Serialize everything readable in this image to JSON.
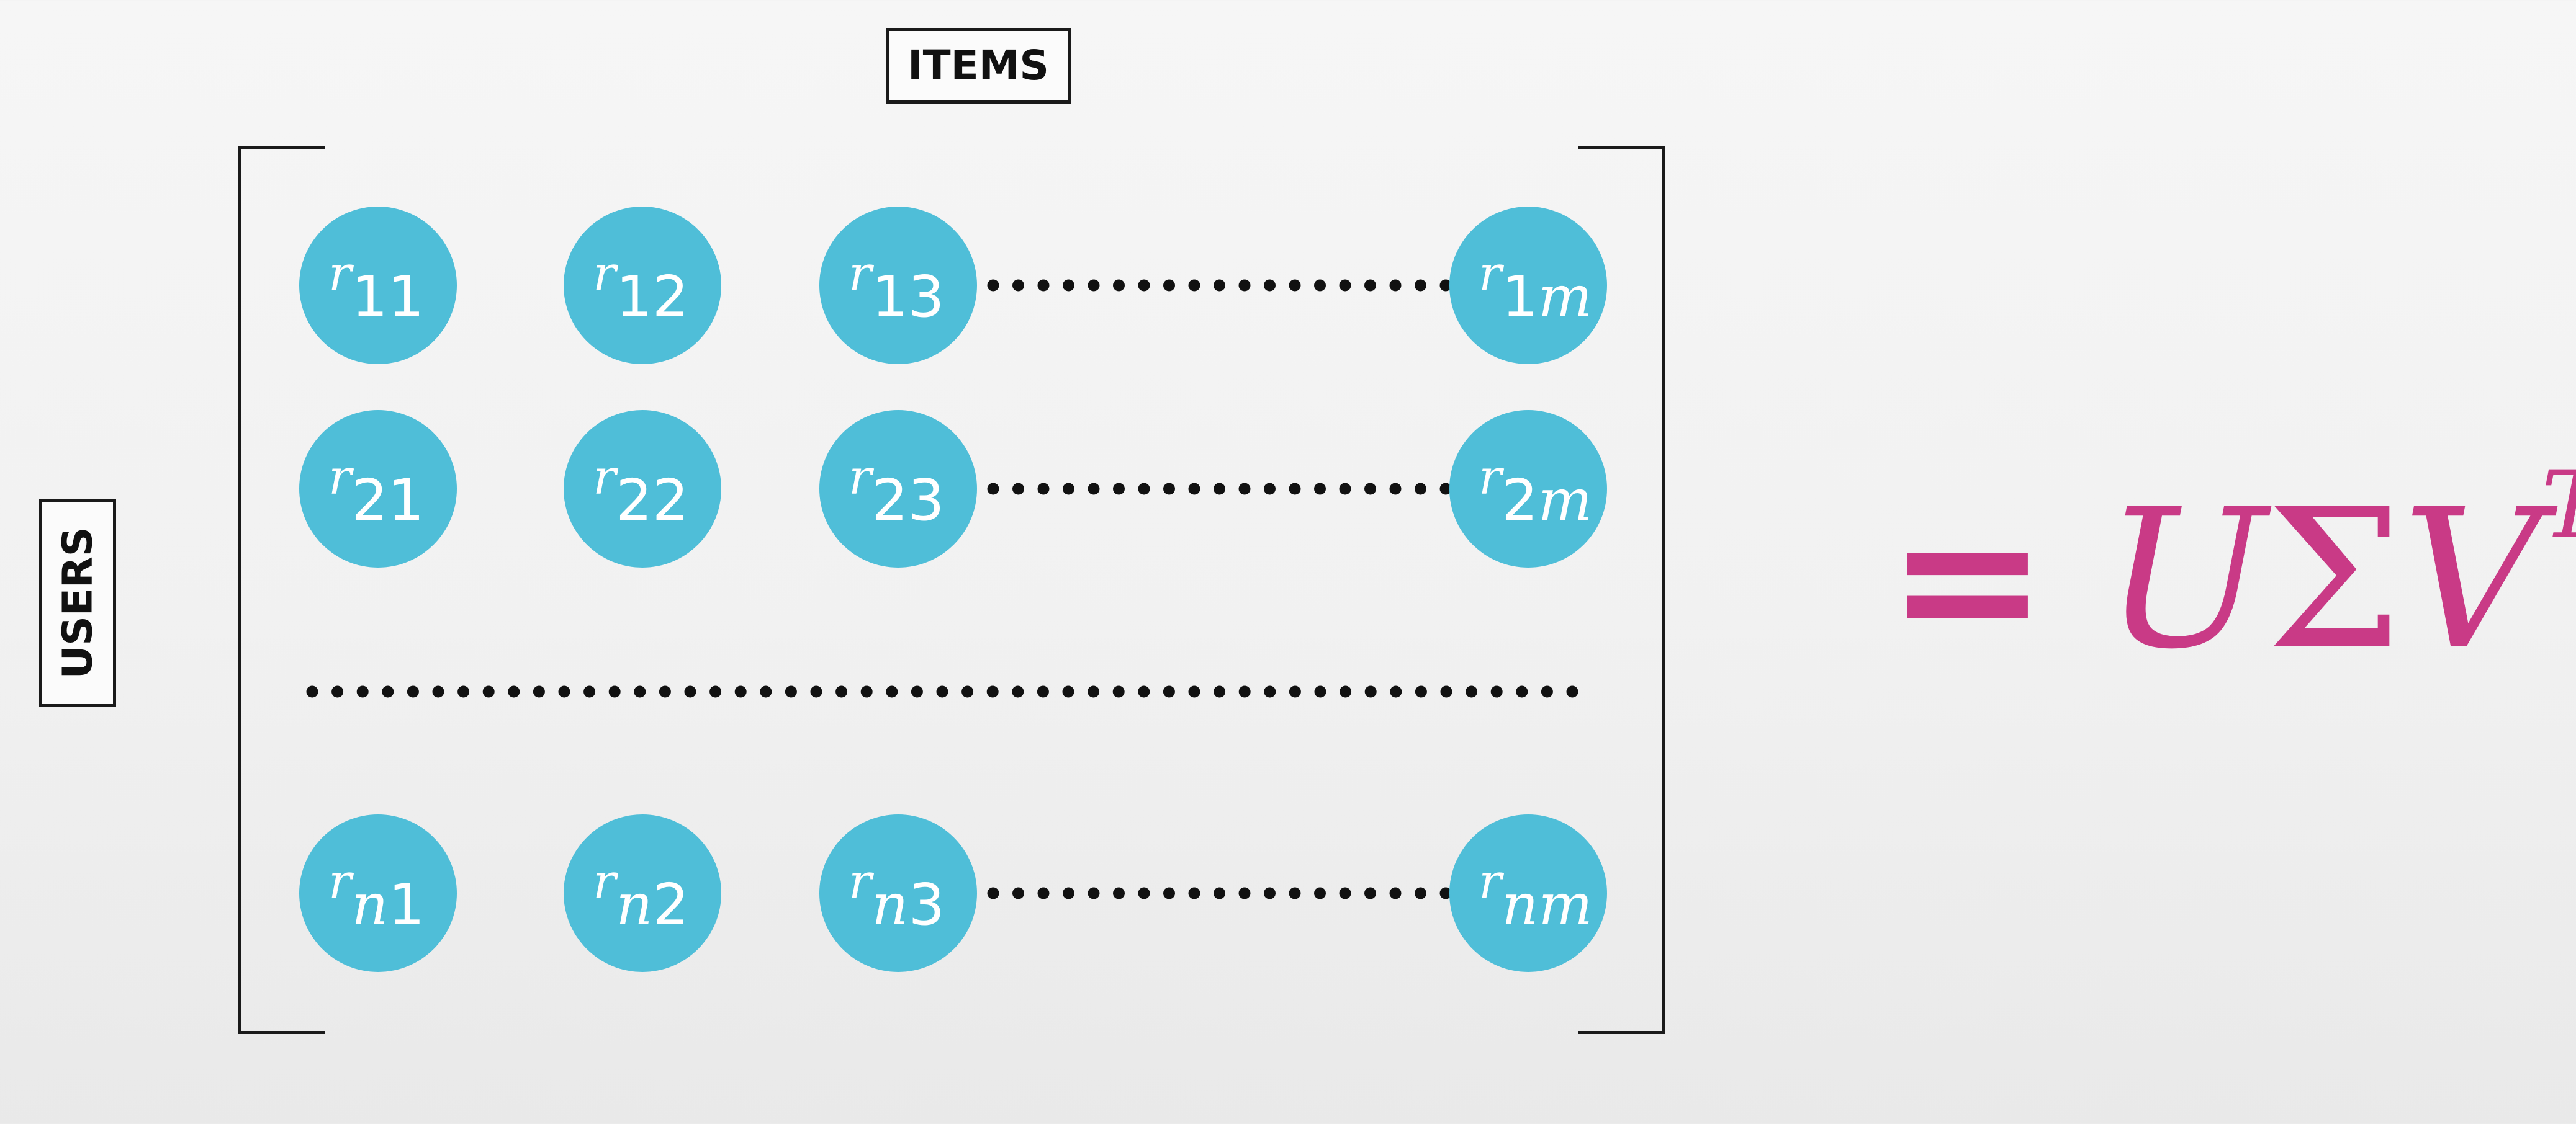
{
  "labels": {
    "columns": "ITEMS",
    "rows": "USERS"
  },
  "matrix": {
    "rows": [
      [
        "r11",
        "r12",
        "r13",
        "r1m"
      ],
      [
        "r21",
        "r22",
        "r23",
        "r2m"
      ],
      [
        "rn1",
        "rn2",
        "rn3",
        "rnm"
      ]
    ],
    "cells": [
      [
        {
          "base": "r",
          "sub": "11",
          "italic_sub": ""
        },
        {
          "base": "r",
          "sub": "12",
          "italic_sub": ""
        },
        {
          "base": "r",
          "sub": "13",
          "italic_sub": ""
        },
        {
          "base": "r",
          "sub": "1",
          "italic_sub": "m"
        }
      ],
      [
        {
          "base": "r",
          "sub": "21",
          "italic_sub": ""
        },
        {
          "base": "r",
          "sub": "22",
          "italic_sub": ""
        },
        {
          "base": "r",
          "sub": "23",
          "italic_sub": ""
        },
        {
          "base": "r",
          "sub": "2",
          "italic_sub": "m"
        }
      ],
      [
        {
          "base": "r",
          "sub": "",
          "italic_sub": "n",
          "tail": "1"
        },
        {
          "base": "r",
          "sub": "",
          "italic_sub": "n",
          "tail": "2"
        },
        {
          "base": "r",
          "sub": "",
          "italic_sub": "n",
          "tail": "3"
        },
        {
          "base": "r",
          "sub": "",
          "italic_sub": "nm"
        }
      ]
    ]
  },
  "equation": {
    "equals": "=",
    "u": "U",
    "sigma": "Σ",
    "v": "V",
    "transpose": "T"
  },
  "colors": {
    "cell_fill": "#4fbed8",
    "equation": "#c93a86",
    "dots": "#111111"
  }
}
